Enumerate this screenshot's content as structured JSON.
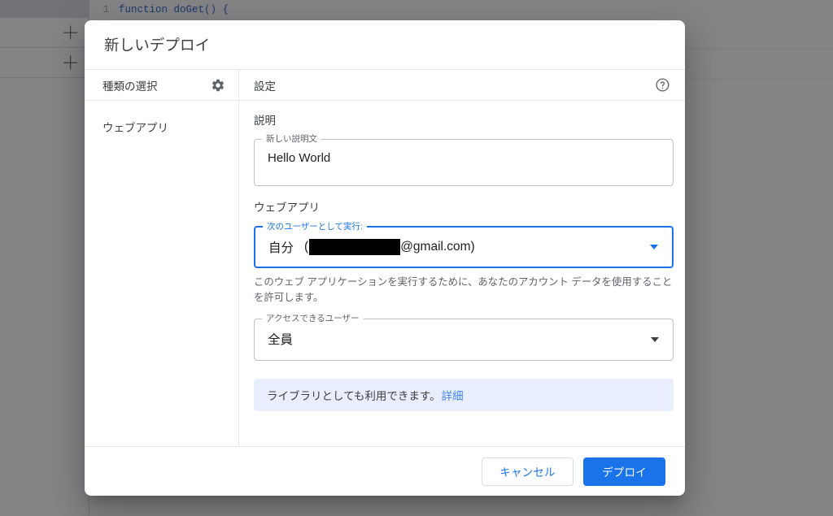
{
  "background": {
    "code_line_number": "1",
    "code_text": "function doGet() {",
    "file_add_label_1": "+",
    "file_add_label_2": "+"
  },
  "dialog": {
    "title": "新しいデプロイ",
    "left_pane": {
      "header": "種類の選択",
      "gear_icon": "gear-icon",
      "items": [
        {
          "label": "ウェブアプリ"
        }
      ]
    },
    "right_pane": {
      "header": "設定",
      "help_icon": "help-circle-icon",
      "description_section_label": "説明",
      "description_field": {
        "legend": "新しい説明文",
        "value": "Hello World"
      },
      "webapp_section_label": "ウェブアプリ",
      "execute_as_field": {
        "legend": "次のユーザーとして実行:",
        "value_prefix": "自分",
        "paren_open": "(",
        "redacted": "",
        "value_suffix": "@gmail.com)",
        "arrow_icon": "chevron-down-icon"
      },
      "helper_text": "このウェブ アプリケーションを実行するために、あなたのアカウント データを使用することを許可します。",
      "access_field": {
        "legend": "アクセスできるユーザー",
        "value": "全員",
        "arrow_icon": "chevron-down-icon"
      },
      "info_banner": {
        "text": "ライブラリとしても利用できます。",
        "link": "詳細"
      }
    },
    "footer": {
      "cancel_label": "キャンセル",
      "deploy_label": "デプロイ"
    }
  },
  "colors": {
    "accent": "#1a73e8",
    "link": "#4285f4",
    "banner_bg": "#e8eefc",
    "scrim": "rgba(32,33,36,0.55)",
    "code_blue": "#1a56c4"
  }
}
